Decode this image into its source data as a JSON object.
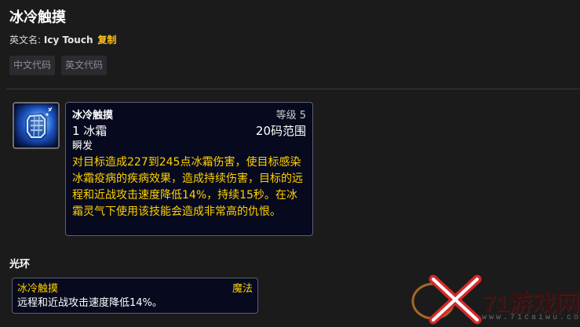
{
  "header": {
    "title": "冰冷触摸",
    "english_label": "英文名:",
    "english_name": "Icy Touch",
    "copy_label": "复制"
  },
  "code_buttons": [
    {
      "label": "中文代码"
    },
    {
      "label": "英文代码"
    }
  ],
  "spell": {
    "icon": "frost-fist-icon",
    "name": "冰冷触摸",
    "level": "等级 5",
    "cost": "1 冰霜",
    "range": "20码范围",
    "cast": "瞬发",
    "description": "对目标造成227到245点冰霜伤害，使目标感染冰霜疫病的疾病效果，造成持续伤害，目标的远程和近战攻击速度降低14%，持续15秒。在冰霜灵气下使用该技能会造成非常高的仇恨。"
  },
  "aura": {
    "heading": "光环",
    "name": "冰冷触摸",
    "type": "魔法",
    "description": "远程和近战攻击速度降低14%。"
  },
  "watermark": {
    "text": "71游戏网",
    "url": "www.71caiwu.com"
  },
  "colors": {
    "background": "#1b1b1b",
    "tooltip_bg": "#070a1e",
    "gold": "#ffd100",
    "copy_link": "#ffc21a"
  }
}
